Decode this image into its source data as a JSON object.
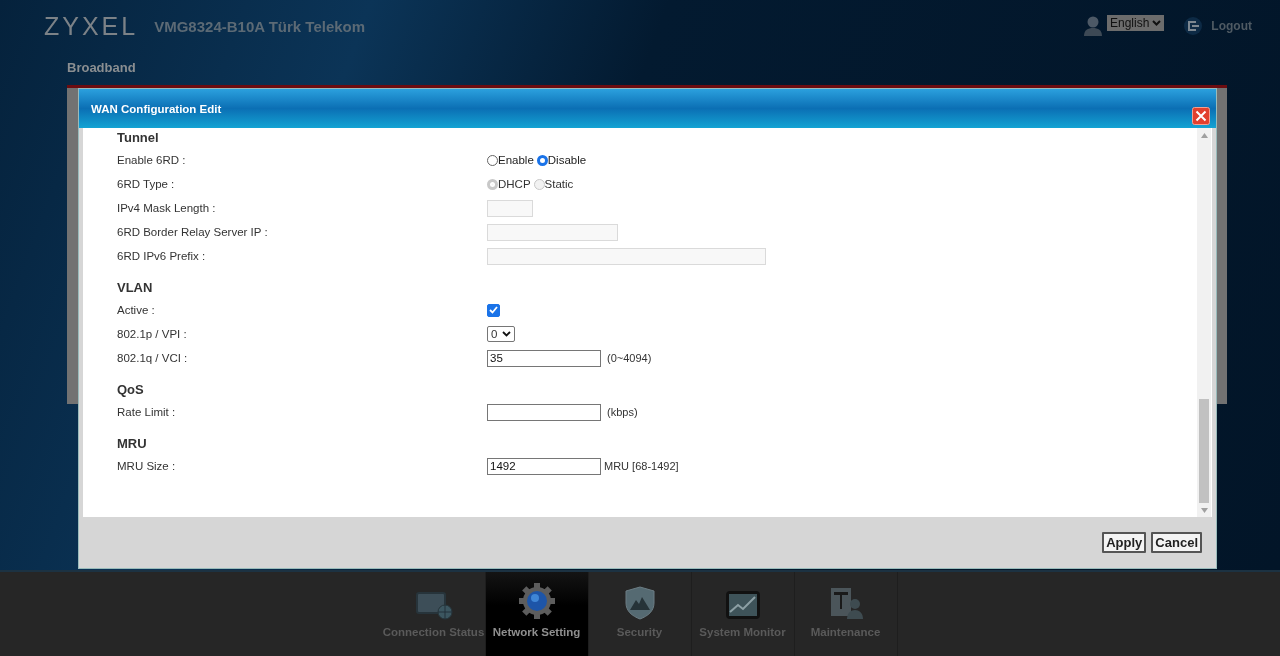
{
  "header": {
    "logo": "ZYXEL",
    "model": "VMG8324-B10A Türk Telekom",
    "language": "English",
    "logout": "Logout"
  },
  "page_title": "Broadband",
  "dialog": {
    "title": "WAN Configuration Edit",
    "sections": [
      {
        "heading": "Tunnel",
        "rows": [
          {
            "label": "Enable 6RD :",
            "kind": "radio",
            "disabled": false,
            "options": [
              {
                "label": "Enable",
                "selected": false
              },
              {
                "label": "Disable",
                "selected": true
              }
            ]
          },
          {
            "label": "6RD Type :",
            "kind": "radio",
            "disabled": true,
            "options": [
              {
                "label": "DHCP",
                "selected": true
              },
              {
                "label": "Static",
                "selected": false
              }
            ]
          },
          {
            "label": "IPv4 Mask Length :",
            "kind": "text",
            "disabled": true
          },
          {
            "label": "6RD Border Relay Server IP :",
            "kind": "text",
            "disabled": true
          },
          {
            "label": "6RD IPv6 Prefix :",
            "kind": "text",
            "disabled": true
          }
        ]
      },
      {
        "heading": "VLAN",
        "rows": [
          {
            "label": "Active :",
            "kind": "checkbox",
            "checked": true
          },
          {
            "label": "802.1p / VPI :",
            "kind": "select",
            "value": "0"
          },
          {
            "label": "802.1q / VCI :",
            "kind": "text",
            "disabled": false,
            "value": "35",
            "unit": "(0~4094)"
          }
        ]
      },
      {
        "heading": "QoS",
        "rows": [
          {
            "label": "Rate Limit :",
            "kind": "text",
            "disabled": false,
            "unit": "(kbps)"
          }
        ]
      },
      {
        "heading": "MRU",
        "rows": [
          {
            "label": "MRU Size :",
            "kind": "text",
            "disabled": false,
            "value": "1492",
            "unit": "MRU [68-1492]"
          }
        ]
      }
    ],
    "buttons": [
      "Apply",
      "Cancel"
    ]
  },
  "nav": [
    {
      "label": "Connection Status",
      "selected": false
    },
    {
      "label": "Network Setting",
      "selected": true
    },
    {
      "label": "Security",
      "selected": false
    },
    {
      "label": "System Monitor",
      "selected": false
    },
    {
      "label": "Maintenance",
      "selected": false
    }
  ]
}
